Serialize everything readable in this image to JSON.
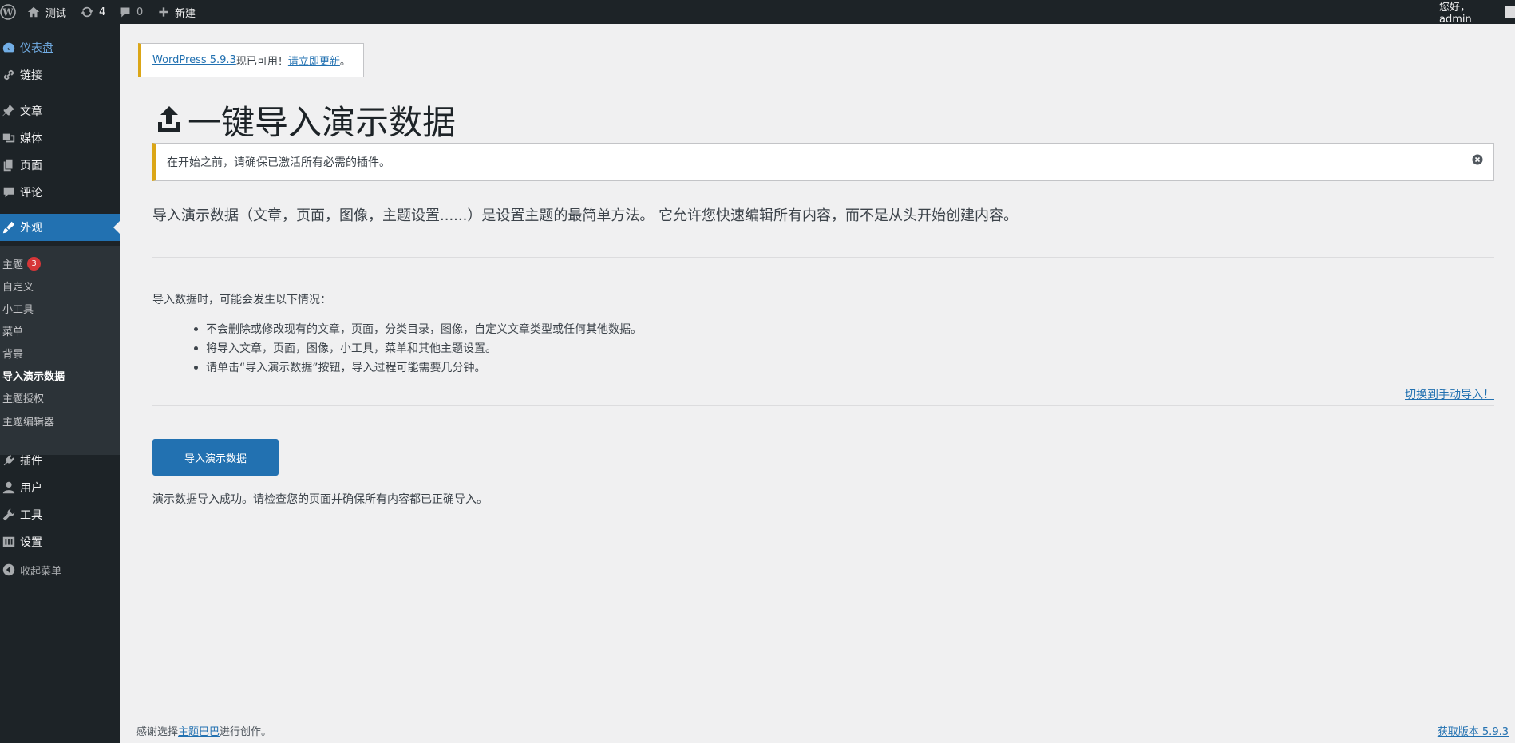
{
  "adminbar": {
    "site_name": "测试",
    "updates_count": "4",
    "comments_count": "0",
    "new_label": "新建",
    "greeting": "您好，admin"
  },
  "sidebar": {
    "items": [
      {
        "label": "仪表盘",
        "icon": "dashboard-icon"
      },
      {
        "label": "链接",
        "icon": "link-icon"
      },
      {
        "label": "文章",
        "icon": "pin-icon"
      },
      {
        "label": "媒体",
        "icon": "media-icon"
      },
      {
        "label": "页面",
        "icon": "page-icon"
      },
      {
        "label": "评论",
        "icon": "comment-icon"
      },
      {
        "label": "外观",
        "icon": "brush-icon"
      },
      {
        "label": "插件",
        "icon": "plugin-icon"
      },
      {
        "label": "用户",
        "icon": "user-icon"
      },
      {
        "label": "工具",
        "icon": "wrench-icon"
      },
      {
        "label": "设置",
        "icon": "settings-icon"
      }
    ],
    "submenu": [
      {
        "label": "主题",
        "badge": "3"
      },
      {
        "label": "自定义"
      },
      {
        "label": "小工具"
      },
      {
        "label": "菜单"
      },
      {
        "label": "背景"
      },
      {
        "label": "导入演示数据"
      },
      {
        "label": "主题授权"
      },
      {
        "label": "主题编辑器"
      }
    ],
    "collapse_label": "收起菜单"
  },
  "update_notice": {
    "link_text": "WordPress 5.9.3",
    "middle_text": "现已可用！",
    "action_text": "请立即更新",
    "suffix": "。"
  },
  "page_title": "一键导入演示数据",
  "warning_notice": "在开始之前，请确保已激活所有必需的插件。",
  "intro_text": "导入演示数据（文章，页面，图像，主题设置......）是设置主题的最简单方法。 它允许您快速编辑所有内容，而不是从头开始创建内容。",
  "list_intro": "导入数据时，可能会发生以下情况：",
  "bullets": [
    "不会删除或修改现有的文章，页面，分类目录，图像，自定义文章类型或任何其他数据。",
    "将导入文章，页面，图像，小工具，菜单和其他主题设置。",
    "请单击“导入演示数据”按钮，导入过程可能需要几分钟。"
  ],
  "switch_link": "切换到手动导入！",
  "import_button": "导入演示数据",
  "success_text": "演示数据导入成功。请检查您的页面并确保所有内容都已正确导入。",
  "footer": {
    "left_prefix": "感谢选择",
    "left_link": "主题巴巴",
    "left_suffix": "进行创作。",
    "right_link": "获取版本 5.9.3"
  },
  "colors": {
    "admin_bg": "#1d2327",
    "accent": "#2271b1",
    "notice_warning": "#dba617",
    "badge": "#d63638"
  }
}
